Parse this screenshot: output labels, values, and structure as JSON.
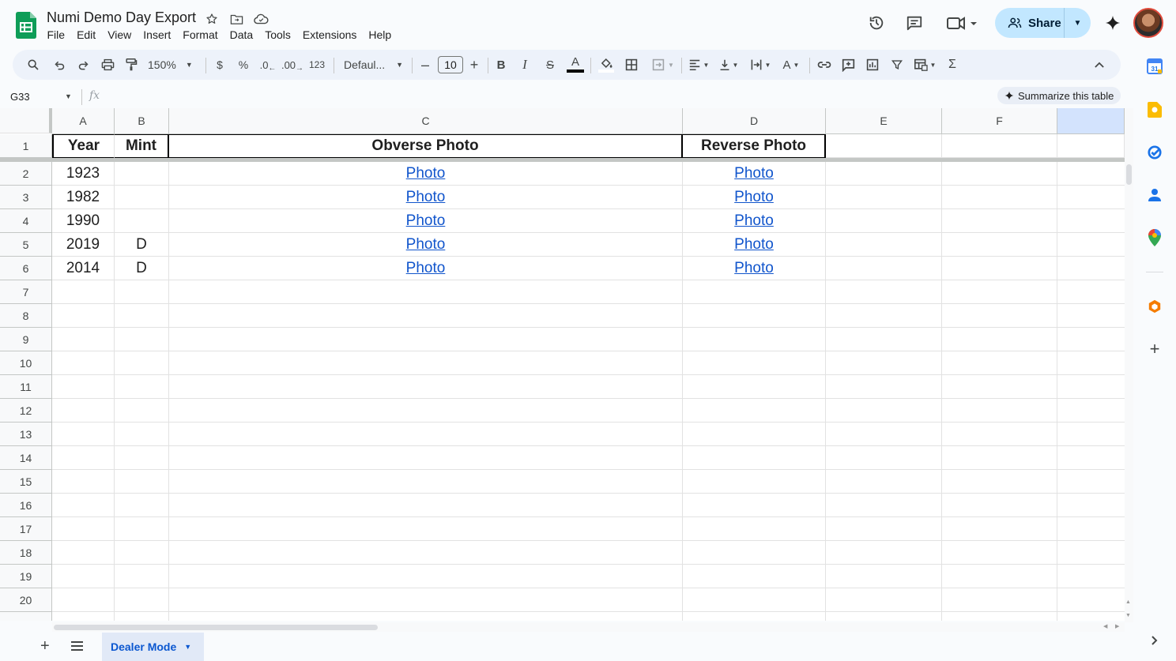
{
  "doc": {
    "title": "Numi Demo Day Export",
    "menu": [
      "File",
      "Edit",
      "View",
      "Insert",
      "Format",
      "Data",
      "Tools",
      "Extensions",
      "Help"
    ]
  },
  "header": {
    "share_label": "Share"
  },
  "toolbar": {
    "zoom": "150%",
    "currency": "$",
    "percent": "%",
    "decrease_decimal": ".0",
    "increase_decimal": ".00",
    "number_format": "123",
    "font": "Defaul...",
    "font_size": "10"
  },
  "formula_bar": {
    "name_box": "G33",
    "fx": "fx",
    "summarize_label": "Summarize this table"
  },
  "grid": {
    "columns": [
      "A",
      "B",
      "C",
      "D",
      "E",
      "F"
    ],
    "row_numbers": [
      "1",
      "2",
      "3",
      "4",
      "5",
      "6",
      "7",
      "8",
      "9",
      "10",
      "11",
      "12",
      "13",
      "14",
      "15",
      "16",
      "17",
      "18",
      "19",
      "20"
    ],
    "headers": [
      "Year",
      "Mint",
      "Obverse Photo",
      "Reverse Photo"
    ],
    "rows": [
      {
        "year": "1923",
        "mint": "",
        "obverse": "Photo",
        "reverse": "Photo"
      },
      {
        "year": "1982",
        "mint": "",
        "obverse": "Photo",
        "reverse": "Photo"
      },
      {
        "year": "1990",
        "mint": "",
        "obverse": "Photo",
        "reverse": "Photo"
      },
      {
        "year": "2019",
        "mint": "D",
        "obverse": "Photo",
        "reverse": "Photo"
      },
      {
        "year": "2014",
        "mint": "D",
        "obverse": "Photo",
        "reverse": "Photo"
      }
    ]
  },
  "sheets": {
    "active": "Dealer Mode"
  },
  "colors": {
    "accent": "#0b57d0",
    "link": "#1155cc",
    "share_bg": "#c2e7ff",
    "sheets_green": "#0f9d58"
  },
  "side_panel": {
    "calendar_day": "31"
  }
}
